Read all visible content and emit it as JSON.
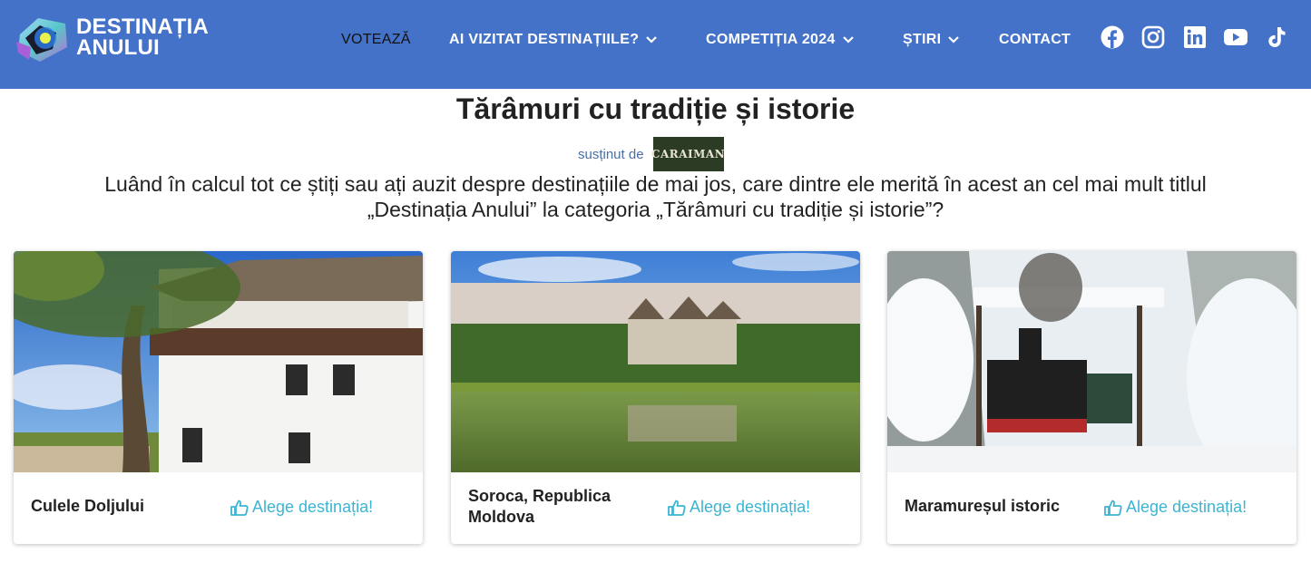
{
  "brand": {
    "line1": "DESTINAȚIA",
    "line2": "ANULUI"
  },
  "nav": [
    {
      "label": "VOTEAZĂ"
    },
    {
      "label": "AI VIZITAT DESTINAȚIILE?"
    },
    {
      "label": "COMPETIȚIA 2024"
    },
    {
      "label": "ȘTIRI"
    },
    {
      "label": "CONTACT"
    }
  ],
  "social": [
    "facebook-icon",
    "instagram-icon",
    "linkedin-icon",
    "youtube-icon",
    "tiktok-icon"
  ],
  "page": {
    "title": "Tărâmuri cu tradiție și istorie",
    "sponsor_label": "susținut de",
    "sponsor_name": "CARAIMAN",
    "question_line1": "Luând în calcul tot ce știți sau ați auzit despre destinațiile de mai jos, care dintre ele merită în acest an cel mai mult titlul",
    "question_line2": "„Destinația Anului” la categoria „Tărâmuri cu tradiție și istorie”?"
  },
  "cards": [
    {
      "name": "Culele Doljului",
      "vote_label": "Alege destinația!"
    },
    {
      "name_line1": "Soroca, Republica",
      "name_line2": "Moldova",
      "vote_label": "Alege destinația!"
    },
    {
      "name": "Maramureșul istoric",
      "vote_label": "Alege destinația!"
    }
  ],
  "colors": {
    "header": "#4472c8",
    "accent": "#3db4d2",
    "sponsor_bg": "#2c3b23"
  }
}
